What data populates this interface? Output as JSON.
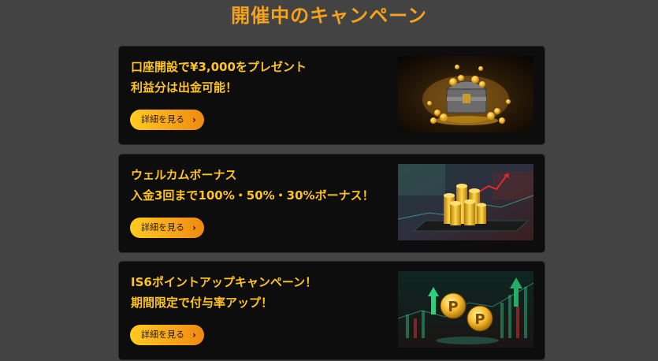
{
  "page": {
    "title": "開催中のキャンペーン"
  },
  "campaigns": [
    {
      "line1": "口座開設で¥3,000をプレゼント",
      "line2": "利益分は出金可能！",
      "button_label": "詳細を見る",
      "button_arrow": "›",
      "image": "treasure-chest-gold-coins"
    },
    {
      "line1": "ウェルカムボーナス",
      "line2": "入金3回まで100%・50%・30%ボーナス！",
      "button_label": "詳細を見る",
      "button_arrow": "›",
      "image": "coin-stacks-growth-chart"
    },
    {
      "line1": "IS6ポイントアップキャンペーン！",
      "line2": "期間限定で付与率アップ！",
      "button_label": "詳細を見る",
      "button_arrow": "›",
      "image": "p-point-coins-chart"
    }
  ],
  "colors": {
    "background": "#434343",
    "title": "#f6a21a",
    "card_text": "#ffc41e",
    "card_bg": "#0d0d0d",
    "button_gradient_start": "#ffcc20",
    "button_gradient_end": "#f08a10"
  }
}
